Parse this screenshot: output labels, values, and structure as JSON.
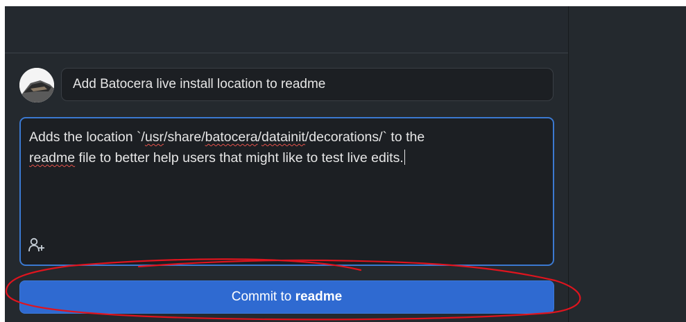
{
  "commit": {
    "summary": "Add Batocera live install location to readme",
    "description": {
      "line1_prefix": "Adds the location `/",
      "word_usr": "usr",
      "slash1": "/share/",
      "word_batocera": "batocera",
      "slash2": "/",
      "word_datainit": "datainit",
      "line1_suffix": "/decorations/` to the",
      "word_readme": "readme",
      "line2_suffix": " file to better help users that might like to test live edits."
    },
    "button_prefix": "Commit to ",
    "branch": "readme"
  },
  "colors": {
    "panel": "#24292e",
    "input_bg": "#1c1f23",
    "focus_border": "#3b79d1",
    "button": "#2f6ad1",
    "annotation": "#e0141e",
    "spellcheck": "#e5534b"
  },
  "icons": {
    "avatar": "avatar-image",
    "coauthor": "add-coauthor-icon"
  }
}
